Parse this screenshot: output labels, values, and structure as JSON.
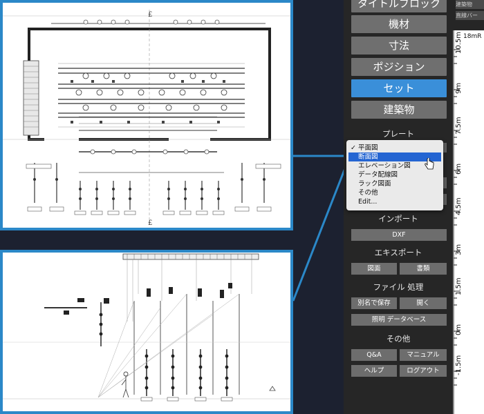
{
  "sidebar": {
    "buttons": [
      "タイトルブロック",
      "機材",
      "寸法",
      "ポジション",
      "セット",
      "建築物"
    ],
    "active_button": "セット",
    "plate_title": "プレート",
    "import_title": "インポート",
    "import_button": "DXF",
    "export_title": "エキスポート",
    "export_buttons": [
      "図面",
      "書類"
    ],
    "file_title": "ファイル 処理",
    "file_buttons": [
      "別名で保存",
      "開く"
    ],
    "db_button": "照明 データベース",
    "other_title": "その他",
    "other_buttons": [
      "Q&A",
      "マニュアル",
      "ヘルプ",
      "ログアウト"
    ]
  },
  "dropdown": {
    "items": [
      "平面図",
      "断面図",
      "エレベーション図",
      "データ配線図",
      "ラック図面",
      "その他",
      "Edit..."
    ],
    "checked": "平面図",
    "highlighted": "断面図"
  },
  "right_strip": {
    "top_buttons": [
      "建築物",
      "直線バー"
    ],
    "corner_label": "18mR",
    "ruler_labels": [
      "10.5m",
      "9m",
      "7.5m",
      "6m",
      "4.5m",
      "3m",
      "1.5m",
      "0m",
      "-1.5m"
    ]
  },
  "plan_view": {
    "markers": [
      "£",
      "£"
    ]
  },
  "colors": {
    "accent": "#3a8fd9",
    "highlight": "#2465d2",
    "sidebar_bg": "#262626",
    "window_bg": "#1c2130",
    "callout": "#2b88c8"
  }
}
